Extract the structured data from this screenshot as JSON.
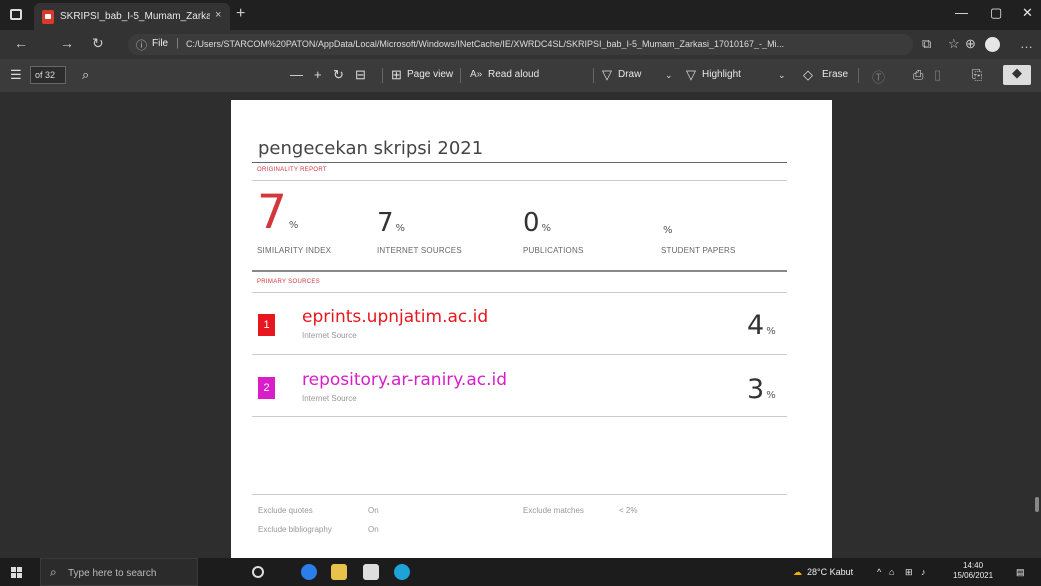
{
  "browser": {
    "tab_title": "SKRIPSI_bab_I-5_Mumam_Zarka",
    "tab_close": "×",
    "new_tab": "+",
    "url_scheme": "File",
    "url": "C:/Users/STARCOM%20PATON/AppData/Local/Microsoft/Windows/INetCache/IE/XWRDC4SL/SKRIPSI_bab_I-5_Mumam_Zarkasi_17010167_-_Mi...",
    "window_controls": [
      "—",
      "▢",
      "✕"
    ]
  },
  "pdf_toolbar": {
    "page_value": "of 32",
    "page_view": "Page view",
    "read_aloud": "Read aloud",
    "draw": "Draw",
    "highlight": "Highlight",
    "erase": "Erase",
    "zoom_out": "—",
    "zoom_in": "+"
  },
  "report": {
    "title": "pengecekan skripsi 2021",
    "originality_label": "ORIGINALITY REPORT",
    "stats": [
      {
        "value": "7",
        "unit": "%",
        "label": "SIMILARITY INDEX"
      },
      {
        "value": "7",
        "unit": "%",
        "label": "INTERNET SOURCES"
      },
      {
        "value": "0",
        "unit": "%",
        "label": "PUBLICATIONS"
      },
      {
        "value": "",
        "unit": "%",
        "label": "STUDENT PAPERS"
      }
    ],
    "primary_sources_label": "PRIMARY SOURCES",
    "sources": [
      {
        "rank": "1",
        "name": "eprints.upnjatim.ac.id",
        "type": "Internet Source",
        "value": "4",
        "unit": "%",
        "color": "#e8161e"
      },
      {
        "rank": "2",
        "name": "repository.ar-raniry.ac.id",
        "type": "Internet Source",
        "value": "3",
        "unit": "%",
        "color": "#d91ec9"
      }
    ],
    "footer": {
      "exclude_quotes_label": "Exclude quotes",
      "exclude_quotes_value": "On",
      "exclude_bibliography_label": "Exclude bibliography",
      "exclude_bibliography_value": "On",
      "exclude_matches_label": "Exclude matches",
      "exclude_matches_value": "< 2%"
    }
  },
  "taskbar": {
    "search_placeholder": "Type here to search",
    "weather": "28°C Kabut",
    "time": "14:40",
    "date": "15/06/2021"
  }
}
